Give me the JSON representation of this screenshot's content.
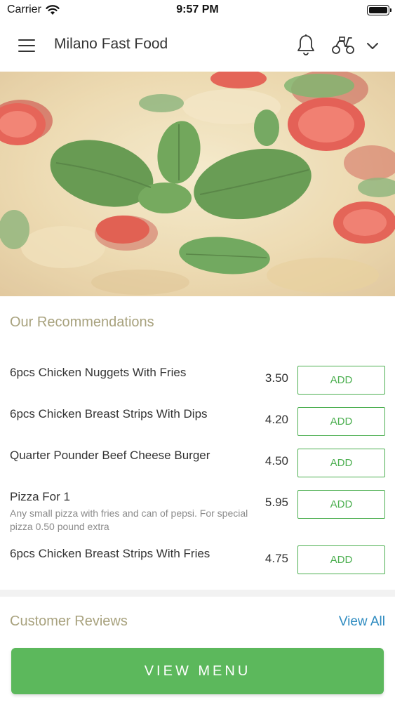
{
  "status_bar": {
    "carrier": "Carrier",
    "time": "9:57 PM"
  },
  "header": {
    "title": "Milano Fast Food",
    "icons": [
      "hamburger-menu-icon",
      "bell-icon",
      "scooter-icon",
      "chevron-down-icon"
    ]
  },
  "recommendations": {
    "title": "Our Recommendations",
    "items": [
      {
        "name": "6pcs Chicken Nuggets With Fries",
        "description": "",
        "price": "3.50",
        "button": "ADD"
      },
      {
        "name": "6pcs Chicken Breast Strips With Dips",
        "description": "",
        "price": "4.20",
        "button": "ADD"
      },
      {
        "name": "Quarter Pounder Beef Cheese Burger",
        "description": "",
        "price": "4.50",
        "button": "ADD"
      },
      {
        "name": "Pizza For 1",
        "description": "Any small pizza with fries and can of pepsi. For special pizza  0.50 pound extra",
        "price": "5.95",
        "button": "ADD"
      },
      {
        "name": "6pcs Chicken Breast Strips With Fries",
        "description": "",
        "price": "4.75",
        "button": "ADD"
      }
    ]
  },
  "reviews": {
    "title": "Customer Reviews",
    "view_all": "View All"
  },
  "footer": {
    "view_menu": "VIEW MENU"
  },
  "colors": {
    "accent_green": "#5cb85c",
    "section_title": "#a8a27e",
    "link_blue": "#2e8bc0"
  }
}
